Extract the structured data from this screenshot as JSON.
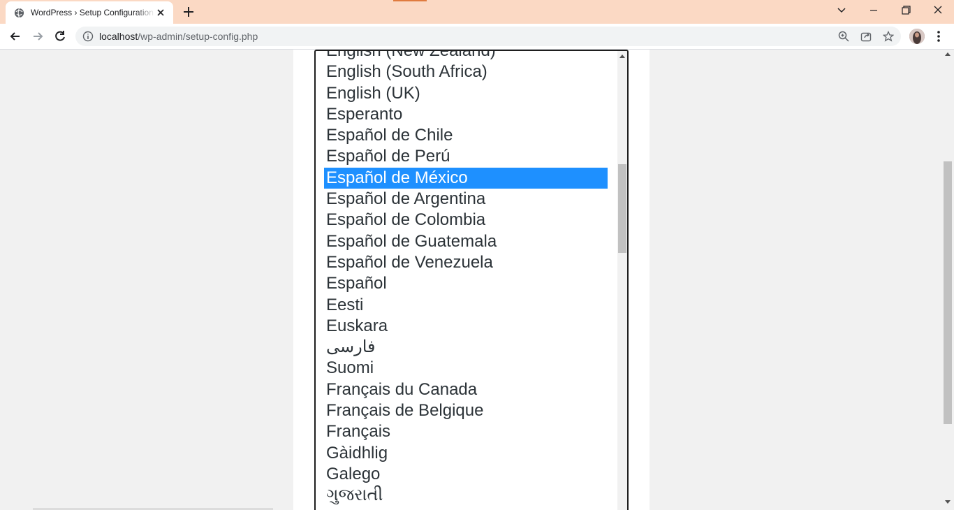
{
  "browser": {
    "tab_title": "WordPress › Setup Configuration",
    "url_host": "localhost",
    "url_path": "/wp-admin/setup-config.php"
  },
  "language_list": {
    "selected_index": 6,
    "options": [
      "English (New Zealand)",
      "English (South Africa)",
      "English (UK)",
      "Esperanto",
      "Español de Chile",
      "Español de Perú",
      "Español de México",
      "Español de Argentina",
      "Español de Colombia",
      "Español de Guatemala",
      "Español de Venezuela",
      "Español",
      "Eesti",
      "Euskara",
      "فارسی",
      "Suomi",
      "Français du Canada",
      "Français de Belgique",
      "Français",
      "Gàidhlig",
      "Galego",
      "ગુજરાતી"
    ]
  },
  "colors": {
    "tabbar": "#fbd9c4",
    "selection": "#1e90ff",
    "page_background": "#f1f1f1"
  }
}
